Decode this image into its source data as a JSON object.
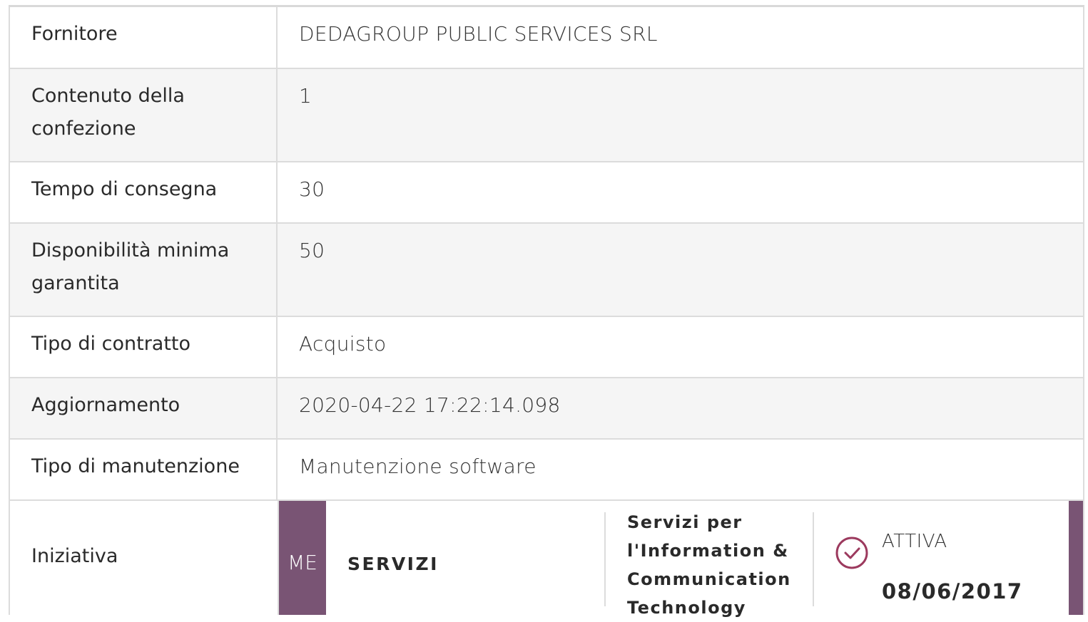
{
  "rows": [
    {
      "label": "Fornitore",
      "value": "DEDAGROUP PUBLIC SERVICES SRL"
    },
    {
      "label_line1": "Contenuto della",
      "label_line2": "confezione",
      "value": "1"
    },
    {
      "label": "Tempo di consegna",
      "value": "30"
    },
    {
      "label_line1": "Disponibilità minima",
      "label_line2": "garantita",
      "value": "50"
    },
    {
      "label": "Tipo di contratto",
      "value": "Acquisto"
    },
    {
      "label": "Aggiornamento",
      "value": "2020-04-22 17:22:14.098"
    },
    {
      "label": "Tipo di manutenzione",
      "value": "Manutenzione software"
    }
  ],
  "iniziativa": {
    "label": "Iniziativa",
    "badge": "ME",
    "category": "SERVIZI",
    "name_line1": "Servizi per",
    "name_line2": "l'Information &",
    "name_line3": "Communication",
    "name_line4": "Technology",
    "status": "ATTIVA",
    "date": "08/06/2017",
    "status_icon": "check-circle-icon",
    "accent_color": "#795474"
  }
}
